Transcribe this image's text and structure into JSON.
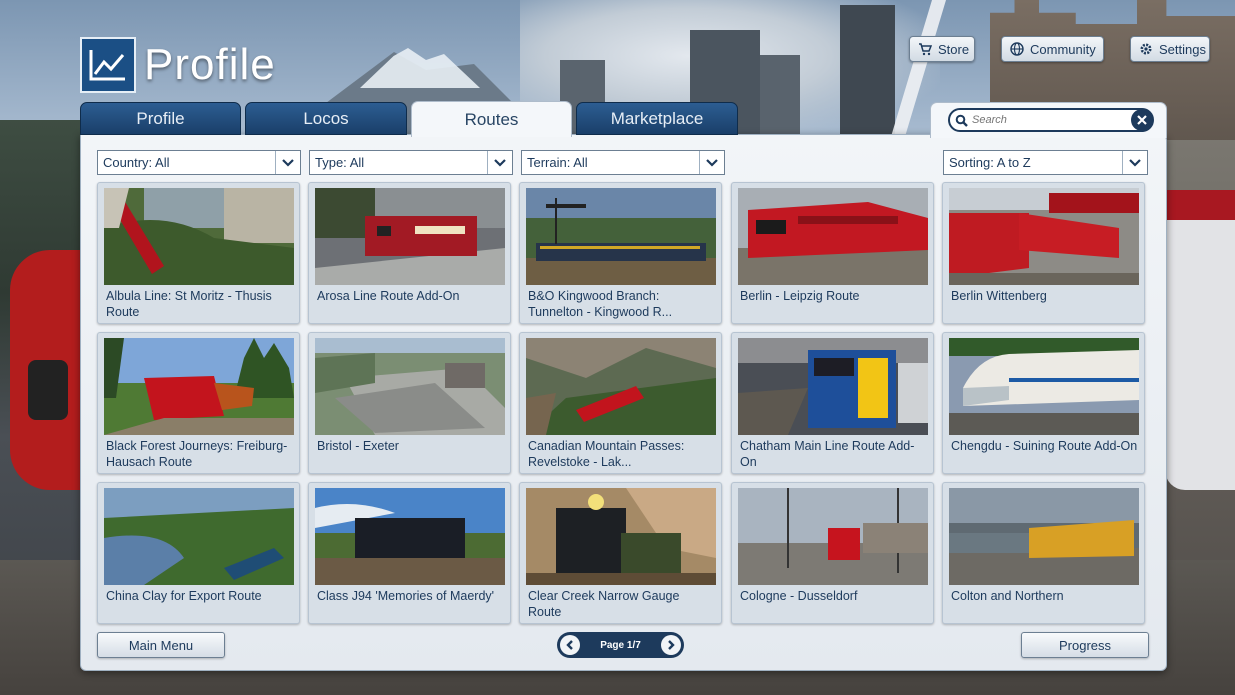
{
  "title": "Profile",
  "top_buttons": {
    "store": "Store",
    "community": "Community",
    "settings": "Settings"
  },
  "tabs": [
    "Profile",
    "Locos",
    "Routes",
    "Marketplace"
  ],
  "active_tab": "Routes",
  "search": {
    "placeholder": "Search"
  },
  "filters": {
    "country": "Country: All",
    "type": "Type: All",
    "terrain": "Terrain: All",
    "sorting": "Sorting: A to Z"
  },
  "routes": [
    "Albula Line: St Moritz - Thusis Route",
    "Arosa Line Route Add-On",
    "B&O Kingwood Branch: Tunnelton - Kingwood R...",
    "Berlin - Leipzig Route",
    "Berlin Wittenberg",
    "Black Forest Journeys: Freiburg-Hausach Route",
    "Bristol - Exeter",
    "Canadian Mountain Passes: Revelstoke - Lak...",
    "Chatham Main Line Route Add-On",
    "Chengdu - Suining Route Add-On",
    "China Clay for Export Route",
    "Class J94 'Memories of Maerdy'",
    "Clear Creek Narrow Gauge Route",
    "Cologne - Dusseldorf",
    "Colton and Northern"
  ],
  "pager": {
    "label": "Page 1/7"
  },
  "bottom": {
    "main_menu": "Main Menu",
    "progress": "Progress"
  },
  "colors": {
    "navy": "#1d3a5c",
    "tab_blue": "#1a3f69",
    "panel": "#eef2f6",
    "card": "#d7dfe7"
  },
  "icons": {
    "title": "chart-line-icon",
    "store": "cart-icon",
    "community": "globe-icon",
    "settings": "gear-icon",
    "search": "search-icon",
    "clear": "close-icon",
    "dropdown": "chevron-down-icon",
    "prev": "chevron-left-icon",
    "next": "chevron-right-icon"
  }
}
